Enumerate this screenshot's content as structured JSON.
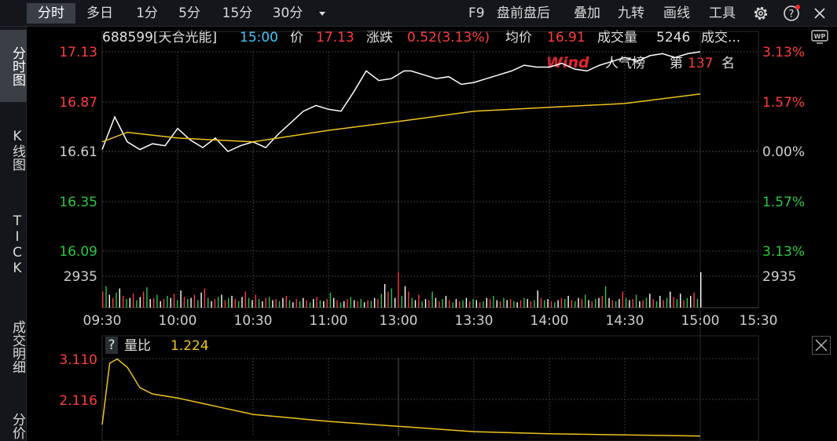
{
  "toolbar": {
    "tabs": [
      {
        "label": "分时",
        "active": true
      },
      {
        "label": "多日",
        "active": false
      },
      {
        "label": "1分",
        "active": false
      },
      {
        "label": "5分",
        "active": false
      },
      {
        "label": "15分",
        "active": false
      },
      {
        "label": "30分",
        "active": false
      }
    ],
    "dropdown_icon": "caret-down-icon",
    "right_items": [
      "F9",
      "盘前盘后",
      "叠加",
      "九转",
      "画线",
      "工具"
    ],
    "right_icons": [
      "gear-icon",
      "help-icon",
      "close-icon"
    ]
  },
  "leftnav": {
    "items": [
      {
        "label": "分时图",
        "active": true
      },
      {
        "label": "K线图",
        "active": false
      },
      {
        "label": "TICK",
        "active": false
      },
      {
        "label": "成交明细",
        "active": false
      },
      {
        "label": "分价",
        "active": false
      }
    ]
  },
  "info": {
    "code_name": "688599[天合光能]",
    "time": "15:00",
    "price_label": "价",
    "price": "17.13",
    "change_label": "涨跌",
    "change": "0.52(3.13%)",
    "avg_label": "均价",
    "avg": "16.91",
    "volume_label": "成交量",
    "volume": "5246",
    "more_label": "成交...",
    "wp_icon": "wp-icon"
  },
  "popularity": {
    "brand": "Wind",
    "label": "人气榜",
    "prefix": "第",
    "rank": "137",
    "suffix": "名"
  },
  "chart_data": [
    {
      "type": "line",
      "price_ticks": [
        "17.13",
        "16.87",
        "16.61",
        "16.35",
        "16.09"
      ],
      "percent_ticks": [
        "3.13%",
        "1.57%",
        "0.00%",
        "1.57%",
        "3.13%"
      ],
      "prev_close": 16.61,
      "ylim": [
        16.09,
        17.13
      ],
      "time_ticks": [
        "09:30",
        "10:00",
        "10:30",
        "11:00",
        "13:00",
        "13:30",
        "14:00",
        "14:30",
        "15:00",
        "15:30"
      ],
      "series": [
        {
          "x": [
            "09:30",
            "09:35",
            "09:40",
            "09:45",
            "09:50",
            "09:55",
            "10:00",
            "10:05",
            "10:10",
            "10:15",
            "10:20",
            "10:25",
            "10:30",
            "10:35",
            "10:40",
            "10:45",
            "10:50",
            "10:55",
            "11:00",
            "11:05",
            "11:10",
            "11:15",
            "11:20",
            "11:25",
            "11:30",
            "13:05",
            "13:10",
            "13:15",
            "13:20",
            "13:25",
            "13:30",
            "13:35",
            "13:40",
            "13:45",
            "13:50",
            "13:55",
            "14:00",
            "14:05",
            "14:10",
            "14:15",
            "14:20",
            "14:25",
            "14:30",
            "14:35",
            "14:40",
            "14:45",
            "14:50",
            "14:55",
            "15:00"
          ],
          "values": [
            16.62,
            16.79,
            16.66,
            16.62,
            16.65,
            16.64,
            16.73,
            16.67,
            16.63,
            16.68,
            16.61,
            16.64,
            16.66,
            16.63,
            16.7,
            16.76,
            16.82,
            16.85,
            16.83,
            16.82,
            16.92,
            17.03,
            16.98,
            16.99,
            17.03,
            17.03,
            17.01,
            16.99,
            17.0,
            16.96,
            16.97,
            16.99,
            17.01,
            17.03,
            17.06,
            17.05,
            17.05,
            17.07,
            17.04,
            17.03,
            17.06,
            17.08,
            17.1,
            17.08,
            17.11,
            17.12,
            17.1,
            17.12,
            17.13
          ]
        },
        {
          "x": [
            "09:30",
            "09:40",
            "10:00",
            "10:30",
            "11:00",
            "11:30",
            "13:30",
            "14:00",
            "14:30",
            "15:00"
          ],
          "values": [
            16.66,
            16.71,
            16.68,
            16.66,
            16.72,
            16.77,
            16.82,
            16.84,
            16.86,
            16.91
          ]
        }
      ]
    },
    {
      "type": "bar",
      "ytick": "2935",
      "ymax": 2935,
      "x_start": "09:30",
      "x_end": "15:00",
      "values": [
        1500,
        2000,
        1200,
        900,
        1400,
        1800,
        1100,
        800,
        900,
        1300,
        700,
        1000,
        1500,
        1900,
        800,
        900,
        1200,
        600,
        800,
        1100,
        900,
        1300,
        700,
        1600,
        1000,
        800,
        900,
        1200,
        700,
        1400,
        1800,
        900,
        600,
        800,
        1000,
        1200,
        700,
        900,
        1100,
        800,
        600,
        1000,
        1500,
        900,
        700,
        1200,
        800,
        600,
        900,
        1000,
        700,
        800,
        600,
        900,
        1100,
        700,
        500,
        800,
        600,
        900,
        700,
        500,
        800,
        1000,
        700,
        600,
        800,
        1400,
        900,
        700,
        500,
        600,
        800,
        1000,
        700,
        600,
        800,
        500,
        700,
        600,
        900,
        800,
        1300,
        2200,
        1500,
        1800,
        900,
        3300,
        1100,
        2000,
        1500,
        900,
        700,
        1200,
        600,
        800,
        700,
        1500,
        900,
        600,
        800,
        1100,
        700,
        500,
        800,
        600,
        700,
        900,
        600,
        800,
        700,
        500,
        600,
        900,
        800,
        1100,
        700,
        600,
        900,
        700,
        800,
        600,
        500,
        700,
        900,
        800,
        600,
        700,
        1600,
        900,
        700,
        800,
        600,
        500,
        700,
        900,
        800,
        1100,
        700,
        600,
        900,
        800,
        1200,
        700,
        600,
        800,
        900,
        1100,
        2000,
        900,
        700,
        600,
        800,
        1500,
        900,
        700,
        800,
        1200,
        600,
        700,
        900,
        1300,
        800,
        600,
        1100,
        700,
        900,
        1500,
        1000,
        800,
        1300,
        700,
        900,
        1100,
        1400,
        800,
        3300
      ]
    },
    {
      "type": "line",
      "label": "量比",
      "value": "1.224",
      "yticks": [
        "3.110",
        "2.116"
      ],
      "help_icon": "question-icon",
      "x": [
        "09:30",
        "09:33",
        "09:36",
        "09:40",
        "09:45",
        "09:50",
        "10:00",
        "10:15",
        "10:30",
        "11:00",
        "11:30",
        "13:30",
        "14:00",
        "14:30",
        "15:00"
      ],
      "values": [
        1.5,
        3.0,
        3.1,
        2.9,
        2.4,
        2.25,
        2.15,
        1.95,
        1.75,
        1.58,
        1.45,
        1.33,
        1.28,
        1.25,
        1.224
      ]
    }
  ]
}
